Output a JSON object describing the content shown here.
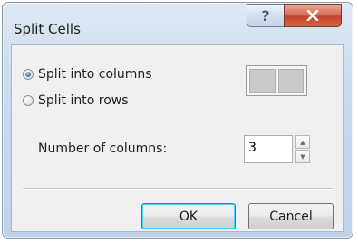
{
  "dialog": {
    "title": "Split Cells",
    "help_glyph": "?",
    "close_glyph": "✕"
  },
  "options": {
    "split_columns_label": "Split into columns",
    "split_columns_selected": true,
    "split_rows_label": "Split into rows",
    "split_rows_selected": false
  },
  "count": {
    "label": "Number of columns:",
    "value": "3",
    "up_glyph": "▲",
    "down_glyph": "▼"
  },
  "buttons": {
    "ok_label": "OK",
    "cancel_label": "Cancel"
  },
  "colors": {
    "close_button": "#c2452a",
    "ok_focus_border": "#3c7fb1"
  }
}
